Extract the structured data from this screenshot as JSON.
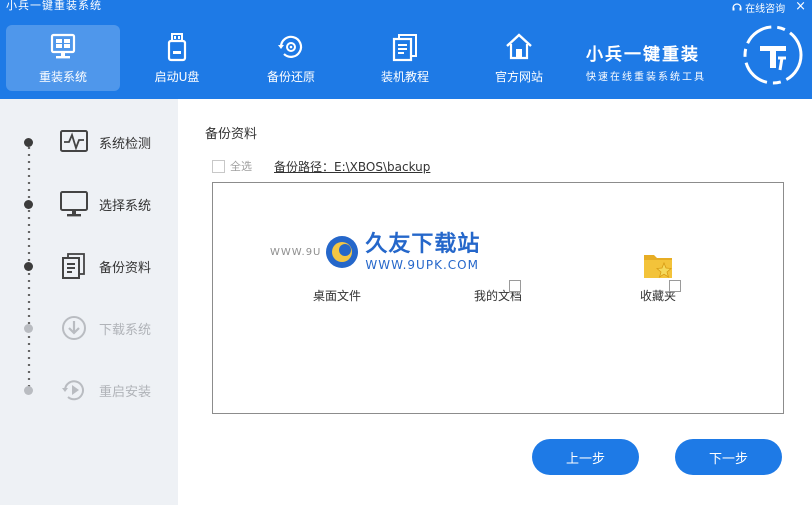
{
  "window": {
    "title": "小兵一键重装系统",
    "online_help": "在线咨询",
    "close_glyph": "×"
  },
  "nav": [
    {
      "label": "重装系统",
      "icon": "monitor-icon",
      "active": true
    },
    {
      "label": "启动U盘",
      "icon": "usb-drive-icon",
      "active": false
    },
    {
      "label": "备份还原",
      "icon": "backup-restore-icon",
      "active": false
    },
    {
      "label": "装机教程",
      "icon": "document-icon",
      "active": false
    },
    {
      "label": "官方网站",
      "icon": "home-icon",
      "active": false
    }
  ],
  "brand": {
    "name": "小兵一键重装",
    "slogan": "快速在线重装系统工具"
  },
  "steps": [
    {
      "label": "系统检测",
      "icon": "pulse-icon",
      "enabled": true
    },
    {
      "label": "选择系统",
      "icon": "monitor-icon",
      "enabled": true
    },
    {
      "label": "备份资料",
      "icon": "document-icon",
      "enabled": true
    },
    {
      "label": "下载系统",
      "icon": "download-icon",
      "enabled": false
    },
    {
      "label": "重启安装",
      "icon": "restart-icon",
      "enabled": false
    }
  ],
  "main": {
    "section_title": "备份资料",
    "select_all_label": "全选",
    "backup_path_label": "备份路径：E:\\XBOS\\backup",
    "items": [
      {
        "label": "桌面文件",
        "icon": "desktop-folder-icon"
      },
      {
        "label": "我的文档",
        "icon": "documents-folder-icon"
      },
      {
        "label": "收藏夹",
        "icon": "favorites-folder-icon"
      }
    ]
  },
  "watermark": {
    "url_left": "WWW.9U",
    "name": "久友下载站",
    "url": "WWW.9UPK.COM"
  },
  "buttons": {
    "prev": "上一步",
    "next": "下一步"
  },
  "colors": {
    "brand_blue": "#1e7ae6",
    "sidebar_bg": "#eef1f5",
    "folder_yellow": "#f3c33a"
  }
}
